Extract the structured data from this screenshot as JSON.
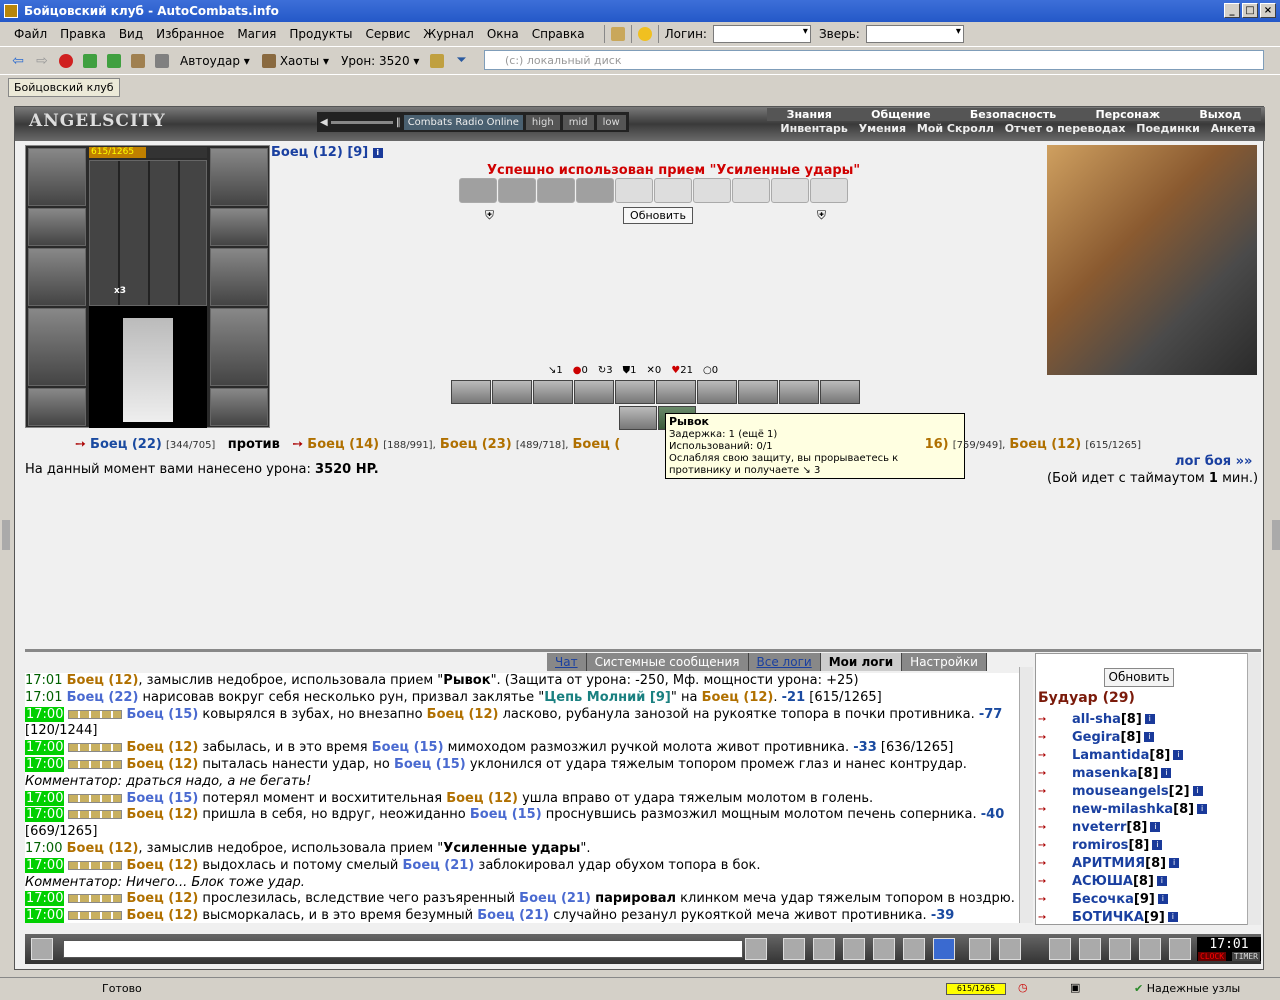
{
  "window": {
    "title": "Бойцовский клуб - AutoCombats.info"
  },
  "menu": {
    "items": [
      "Файл",
      "Правка",
      "Вид",
      "Избранное",
      "Магия",
      "Продукты",
      "Сервис",
      "Журнал",
      "Окна",
      "Справка"
    ],
    "login_label": "Логин:",
    "pet_label": "Зверь:"
  },
  "toolbar": {
    "autohit": "Автоудар",
    "chaos": "Хаоты",
    "damage": "Урон: 3520",
    "address_placeholder": "(c:) локальный диск"
  },
  "tab": {
    "label": "Бойцовский клуб"
  },
  "header": {
    "logo": "ANGELSCITY",
    "radio_label": "Combats Radio Online",
    "q_high": "high",
    "q_mid": "mid",
    "q_low": "low",
    "nav_top": [
      "Знания",
      "Общение",
      "Безопасность",
      "Персонаж",
      "Выход"
    ],
    "nav_bottom": [
      "Инвентарь",
      "Умения",
      "Мой Скролл",
      "Отчет о переводах",
      "Поединки",
      "Анкета"
    ]
  },
  "char": {
    "hp": "615/1265",
    "hp_fraction": 0.486,
    "stack": "x3"
  },
  "fight": {
    "title": "Боец (12) [9]",
    "success": "Успешно использован прием \"Усиленные удары\"",
    "refresh": "Обновить",
    "stats": [
      "1",
      "0",
      "3",
      "1",
      "0",
      "21",
      "0"
    ],
    "tooltip_title": "Рывок",
    "tooltip_delay": "Задержка: 1 (ещё 1)",
    "tooltip_uses": "Использований: 0/1",
    "tooltip_desc": "Ослабляя свою защиту, вы прорываетесь к противнику и получаете ↘ 3",
    "team1": "Боец (22)",
    "team1_hp": "[344/705]",
    "versus": "против",
    "enemy1": "Боец (14)",
    "enemy1_hp": "[188/991],",
    "enemy2": "Боец (23)",
    "enemy2_hp": "[489/718],",
    "enemy3": "Боец (",
    "enemy4_tail": "16)",
    "enemy4_hp": "[759/949],",
    "enemy5": "Боец (12)",
    "enemy5_hp": "[615/1265]",
    "damage_label": "На данный момент вами нанесено урона:",
    "damage_value": "3520 HP.",
    "log_link": "лог боя »»",
    "timeout_pre": "(Бой идет с таймаутом",
    "timeout_val": "1",
    "timeout_post": "мин.)"
  },
  "chat": {
    "tabs": [
      "Чат",
      "Системные сообщения",
      "Все логи",
      "Мои логи",
      "Настройки"
    ],
    "lines": [
      {
        "t": "17:01",
        "g": false,
        "parts": [
          {
            "c": "n1",
            "v": "Боец (12)"
          },
          {
            "c": "",
            "v": ", замыслив недоброе, использовала прием \""
          },
          {
            "c": "b",
            "v": "Рывок"
          },
          {
            "c": "",
            "v": "\". (Защита от урона: -250, Мф. мощности урона: +25)"
          }
        ]
      },
      {
        "t": "17:01",
        "g": false,
        "parts": [
          {
            "c": "n2",
            "v": "Боец (22)"
          },
          {
            "c": "",
            "v": " нарисовав вокруг себя несколько рун, призвал заклятье \""
          },
          {
            "c": "ch",
            "v": "Цепь Молний [9]"
          },
          {
            "c": "",
            "v": "\" на "
          },
          {
            "c": "n1",
            "v": "Боец (12)"
          },
          {
            "c": "",
            "v": ". "
          },
          {
            "c": "dmg",
            "v": "-21"
          },
          {
            "c": "",
            "v": " [615/1265]"
          }
        ]
      },
      {
        "t": "17:00",
        "g": true,
        "parts": [
          {
            "c": "n2",
            "v": "Боец (15)"
          },
          {
            "c": "",
            "v": " ковырялся в зубах, но внезапно "
          },
          {
            "c": "n1",
            "v": "Боец (12)"
          },
          {
            "c": "",
            "v": " ласково, рубанула занозой на рукоятке топора в почки противника. "
          },
          {
            "c": "dmg",
            "v": "-77"
          }
        ]
      },
      {
        "t": "",
        "g": false,
        "parts": [
          {
            "c": "",
            "v": "[120/1244]"
          }
        ]
      },
      {
        "t": "17:00",
        "g": true,
        "parts": [
          {
            "c": "n1",
            "v": "Боец (12)"
          },
          {
            "c": "",
            "v": " забылась, и в это время "
          },
          {
            "c": "n2",
            "v": "Боец (15)"
          },
          {
            "c": "",
            "v": " мимоходом размозжил ручкой молота живот противника. "
          },
          {
            "c": "dmg",
            "v": "-33"
          },
          {
            "c": "",
            "v": " [636/1265]"
          }
        ]
      },
      {
        "t": "17:00",
        "g": true,
        "parts": [
          {
            "c": "n1",
            "v": "Боец (12)"
          },
          {
            "c": "",
            "v": " пыталась нанести удар, но "
          },
          {
            "c": "n2",
            "v": "Боец (15)"
          },
          {
            "c": "",
            "v": " уклонился от удара тяжелым топором промеж глаз и нанес контрудар."
          }
        ]
      },
      {
        "t": "",
        "g": false,
        "parts": [
          {
            "c": "it",
            "v": "Комментатор: драться надо, а не бегать!"
          }
        ]
      },
      {
        "t": "17:00",
        "g": true,
        "parts": [
          {
            "c": "n2",
            "v": "Боец (15)"
          },
          {
            "c": "",
            "v": " потерял момент и восхитительная "
          },
          {
            "c": "n1",
            "v": "Боец (12)"
          },
          {
            "c": "",
            "v": " ушла вправо от удара тяжелым молотом в голень."
          }
        ]
      },
      {
        "t": "17:00",
        "g": true,
        "parts": [
          {
            "c": "n1",
            "v": "Боец (12)"
          },
          {
            "c": "",
            "v": " пришла в себя, но вдруг, неожиданно "
          },
          {
            "c": "n2",
            "v": "Боец (15)"
          },
          {
            "c": "",
            "v": " проснувшись размозжил мощным молотом печень соперника. "
          },
          {
            "c": "dmg",
            "v": "-40"
          }
        ]
      },
      {
        "t": "",
        "g": false,
        "parts": [
          {
            "c": "",
            "v": "[669/1265]"
          }
        ]
      },
      {
        "t": "17:00",
        "g": false,
        "parts": [
          {
            "c": "n1",
            "v": "Боец (12)"
          },
          {
            "c": "",
            "v": ", замыслив недоброе, использовала прием \""
          },
          {
            "c": "b",
            "v": "Усиленные удары"
          },
          {
            "c": "",
            "v": "\"."
          }
        ]
      },
      {
        "t": "17:00",
        "g": true,
        "parts": [
          {
            "c": "n1",
            "v": "Боец (12)"
          },
          {
            "c": "",
            "v": " выдохлась и потому смелый "
          },
          {
            "c": "n2",
            "v": "Боец (21)"
          },
          {
            "c": "",
            "v": " заблокировал удар обухом топора в бок."
          }
        ]
      },
      {
        "t": "",
        "g": false,
        "parts": [
          {
            "c": "it",
            "v": "Комментатор: Ничего... Блок тоже удар."
          }
        ]
      },
      {
        "t": "17:00",
        "g": true,
        "parts": [
          {
            "c": "n1",
            "v": "Боец (12)"
          },
          {
            "c": "",
            "v": " прослезилась, вследствие чего разъяренный "
          },
          {
            "c": "n2",
            "v": "Боец (21)"
          },
          {
            "c": "",
            "v": " "
          },
          {
            "c": "b",
            "v": "парировал"
          },
          {
            "c": "",
            "v": " клинком меча удар тяжелым топором в ноздрю."
          }
        ]
      },
      {
        "t": "17:00",
        "g": true,
        "parts": [
          {
            "c": "n1",
            "v": "Боец (12)"
          },
          {
            "c": "",
            "v": " высморкалась, и в это время безумный "
          },
          {
            "c": "n2",
            "v": "Боец (21)"
          },
          {
            "c": "",
            "v": " случайно резанул рукояткой меча живот противника. "
          },
          {
            "c": "dmg",
            "v": "-39"
          }
        ]
      }
    ]
  },
  "room": {
    "refresh": "Обновить",
    "name": "Будуар (29)",
    "users": [
      {
        "n": "all-sha",
        "l": "[8]"
      },
      {
        "n": "Gegira",
        "l": "[8]"
      },
      {
        "n": "Lamantida",
        "l": "[8]"
      },
      {
        "n": "masenka",
        "l": "[8]"
      },
      {
        "n": "mouseangels",
        "l": "[2]"
      },
      {
        "n": "new-milashka",
        "l": "[8]"
      },
      {
        "n": "nveterr",
        "l": "[8]"
      },
      {
        "n": "romiros",
        "l": "[8]"
      },
      {
        "n": "АРИТМИЯ",
        "l": "[8]"
      },
      {
        "n": "АСЮША",
        "l": "[8]"
      },
      {
        "n": "Бесочка",
        "l": "[9]"
      },
      {
        "n": "БОТИЧКА",
        "l": "[9]"
      }
    ]
  },
  "clock": {
    "time": "17:01",
    "clock_label": "CLOCK",
    "timer_label": "TIMER"
  },
  "status": {
    "ready": "Готово",
    "mini_hp": "615/1265",
    "trust": "Надежные узлы"
  }
}
